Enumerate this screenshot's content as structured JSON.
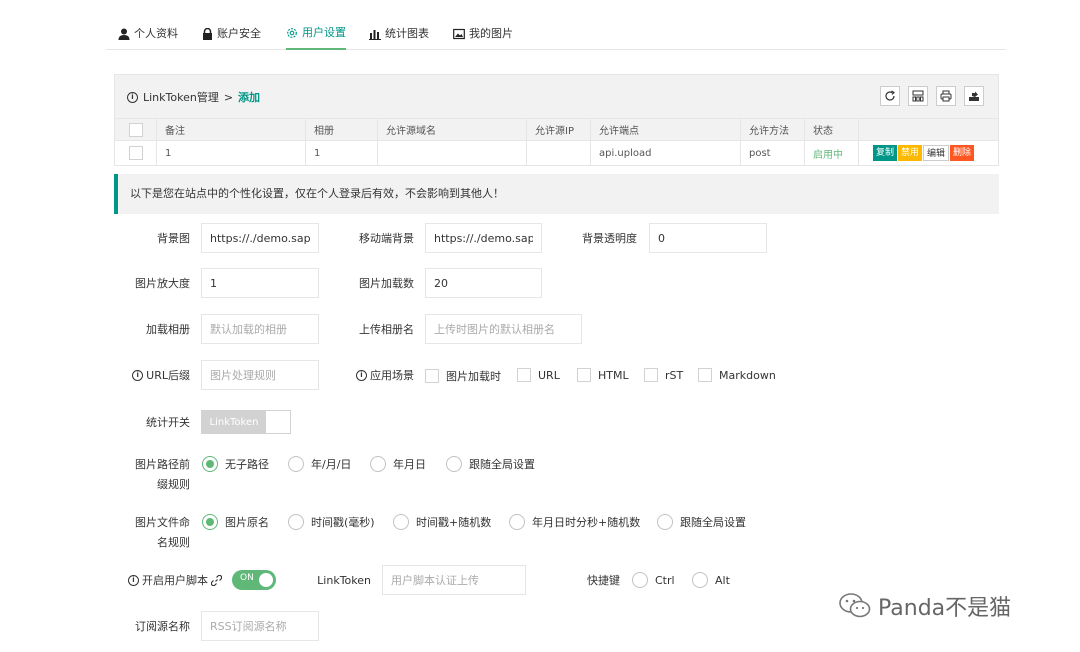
{
  "tabs": [
    {
      "label": "个人资料",
      "icon": "user-icon"
    },
    {
      "label": "账户安全",
      "icon": "lock-icon"
    },
    {
      "label": "用户设置",
      "icon": "gear-icon",
      "active": true
    },
    {
      "label": "统计图表",
      "icon": "bar-chart-icon"
    },
    {
      "label": "我的图片",
      "icon": "image-icon"
    }
  ],
  "linktoken": {
    "breadcrumb": "LinkToken管理",
    "separator": ">",
    "add_label": "添加",
    "columns": [
      "备注",
      "相册",
      "允许源域名",
      "允许源IP",
      "允许端点",
      "允许方法",
      "状态"
    ],
    "row": {
      "remark": "1",
      "album": "1",
      "domain": "",
      "ip": "",
      "endpoint": "api.upload",
      "method": "post",
      "status": "启用中"
    },
    "actions": {
      "copy": "复制",
      "disable": "禁用",
      "edit": "编辑",
      "delete": "删除"
    }
  },
  "notice": "以下是您在站点中的个性化设置，仅在个人登录后有效，不会影响到其他人！",
  "form": {
    "bg_image": {
      "label": "背景图",
      "value": "https://./demo.sapic"
    },
    "mobile_bg": {
      "label": "移动端背景",
      "value": "https://./demo.sapic"
    },
    "bg_opacity": {
      "label": "背景透明度",
      "value": "0"
    },
    "zoom": {
      "label": "图片放大度",
      "value": "1"
    },
    "load_count": {
      "label": "图片加载数",
      "value": "20"
    },
    "load_album": {
      "label": "加载相册",
      "placeholder": "默认加载的相册"
    },
    "upload_album": {
      "label": "上传相册名",
      "placeholder": "上传时图片的默认相册名"
    },
    "url_suffix": {
      "label": "URL后缀",
      "placeholder": "图片处理规则"
    },
    "scene": {
      "label": "应用场景",
      "options": [
        "图片加载时",
        "URL",
        "HTML",
        "rST",
        "Markdown"
      ]
    },
    "stats_switch": {
      "label": "统计开关",
      "value": "LinkToken"
    },
    "path_rule": {
      "label_line1": "图片路径前",
      "label_line2": "缀规则",
      "options": [
        "无子路径",
        "年/月/日",
        "年月日",
        "跟随全局设置"
      ],
      "selected": "无子路径"
    },
    "filename_rule": {
      "label_line1": "图片文件命",
      "label_line2": "名规则",
      "options": [
        "图片原名",
        "时间戳(毫秒)",
        "时间戳+随机数",
        "年月日时分秒+随机数",
        "跟随全局设置"
      ],
      "selected": "图片原名"
    },
    "user_script": {
      "label": "开启用户脚本",
      "toggle": "ON"
    },
    "linktoken_field": {
      "label": "LinkToken",
      "placeholder": "用户脚本认证上传"
    },
    "hotkey": {
      "label": "快捷键",
      "options": [
        "Ctrl",
        "Alt"
      ]
    },
    "rss": {
      "label": "订阅源名称",
      "placeholder": "RSS订阅源名称"
    }
  },
  "watermark": "Panda不是猫",
  "colors": {
    "accent": "#009688",
    "green": "#5FB878",
    "copy": "#009688",
    "disable": "#FFB800",
    "delete": "#FF5722"
  }
}
